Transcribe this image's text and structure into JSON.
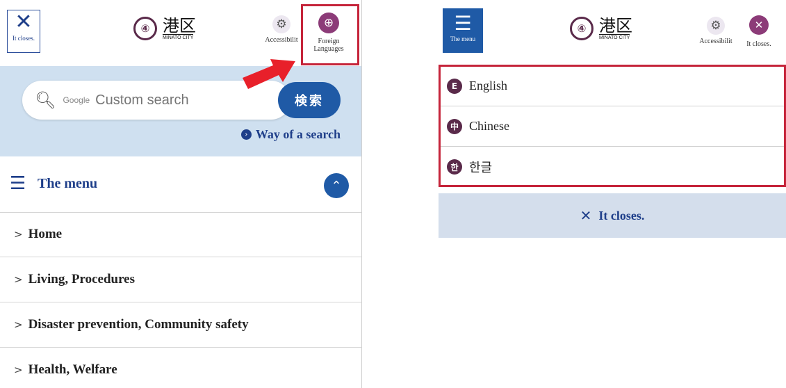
{
  "left": {
    "header": {
      "close_label": "It closes.",
      "logo": {
        "jp": "港区",
        "en": "MINATO CITY",
        "mark": "④"
      },
      "accessibility_label": "Accessibilit",
      "foreign_label_line1": "Foreign",
      "foreign_label_line2": "Languages",
      "accessibility_icon": "gear-icon",
      "foreign_icon": "globe-icon"
    },
    "search": {
      "brand": "Google",
      "placeholder": "Custom search",
      "button_label": "検索",
      "help_link": "Way of a search"
    },
    "menu": {
      "title": "The menu",
      "items": [
        {
          "label": "Home"
        },
        {
          "label": "Living, Procedures"
        },
        {
          "label": "Disaster prevention, Community safety"
        },
        {
          "label": "Health, Welfare"
        }
      ]
    }
  },
  "right": {
    "header": {
      "menu_label": "The menu",
      "logo": {
        "jp": "港区",
        "en": "MINATO CITY",
        "mark": "④"
      },
      "accessibility_label": "Accessibilit",
      "close_label": "It closes."
    },
    "languages": [
      {
        "badge": "E",
        "label": "English"
      },
      {
        "badge": "中",
        "label": "Chinese"
      },
      {
        "badge": "한",
        "label": "한글"
      }
    ],
    "close_bar_label": "It closes."
  },
  "colors": {
    "accent_blue": "#1f5aa6",
    "brand_purple": "#8c3b78",
    "highlight_red": "#c5243a",
    "search_band": "#cfe0f0"
  }
}
